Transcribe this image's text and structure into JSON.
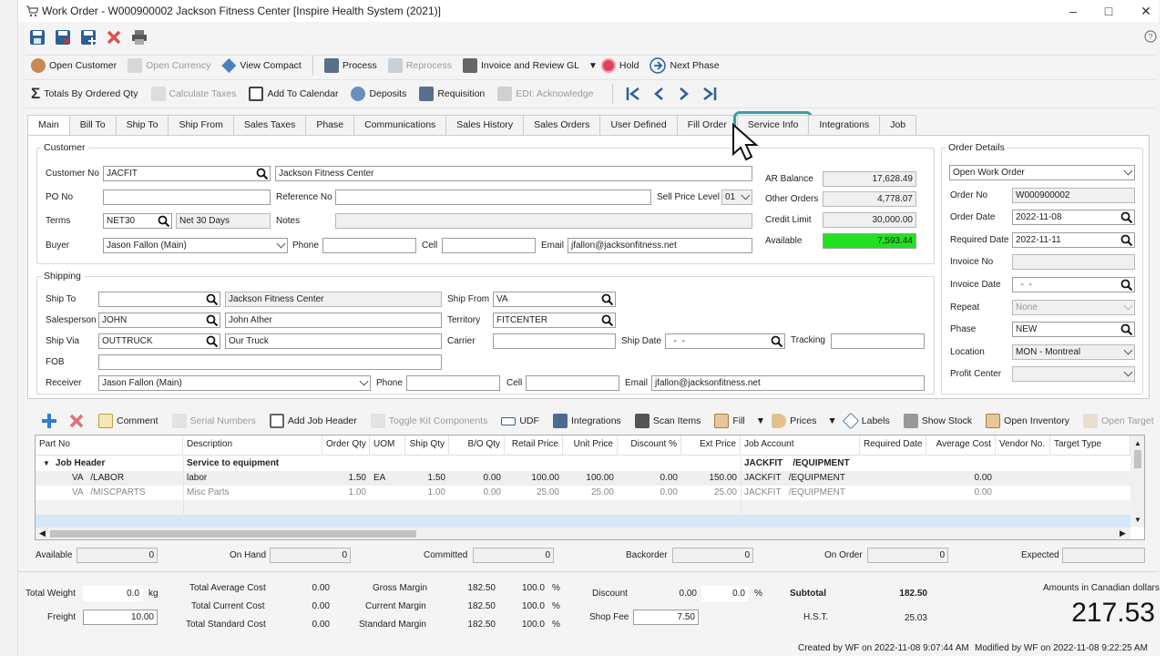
{
  "window": {
    "title": "Work Order - W000900002 Jackson Fitness Center [Inspire Health System (2021)]"
  },
  "toolbar1": [
    "Open Customer",
    "Open Currency",
    "View Compact",
    "Process",
    "Reprocess",
    "Invoice and Review GL",
    "Hold",
    "Next Phase"
  ],
  "toolbar2": [
    "Totals By Ordered Qty",
    "Calculate Taxes",
    "Add To Calendar",
    "Deposits",
    "Requisition",
    "EDI: Acknowledge"
  ],
  "tabs": [
    "Main",
    "Bill To",
    "Ship To",
    "Ship From",
    "Sales Taxes",
    "Phase",
    "Communications",
    "Sales History",
    "Sales Orders",
    "User Defined",
    "Fill Order",
    "Service Info",
    "Integrations",
    "Job"
  ],
  "customer": {
    "title": "Customer",
    "customer_no_label": "Customer No",
    "customer_no": "JACFIT",
    "customer_name": "Jackson Fitness Center",
    "po_label": "PO No",
    "po": "",
    "reference_label": "Reference No",
    "reference": "",
    "sell_price_label": "Sell Price Level",
    "sell_price": "01",
    "terms_label": "Terms",
    "terms": "NET30",
    "terms_desc": "Net 30 Days",
    "notes_label": "Notes",
    "notes": "",
    "buyer_label": "Buyer",
    "buyer": "Jason Fallon (Main)",
    "phone_label": "Phone",
    "phone": "",
    "cell_label": "Cell",
    "cell": "",
    "email_label": "Email",
    "email": "jfallon@jacksonfitness.net",
    "ar_balance_label": "AR Balance",
    "ar_balance": "17,628.49",
    "other_orders_label": "Other Orders",
    "other_orders": "4,778.07",
    "credit_limit_label": "Credit Limit",
    "credit_limit": "30,000.00",
    "available_label": "Available",
    "available": "7,593.44"
  },
  "shipping": {
    "title": "Shipping",
    "ship_to_label": "Ship To",
    "ship_to": "",
    "ship_to_name": "Jackson Fitness Center",
    "ship_from_label": "Ship From",
    "ship_from": "VA",
    "salesperson_label": "Salesperson",
    "salesperson": "JOHN",
    "salesperson_name": "John Ather",
    "territory_label": "Territory",
    "territory": "FITCENTER",
    "ship_via_label": "Ship Via",
    "ship_via": "OUTTRUCK",
    "ship_via_name": "Our Truck",
    "carrier_label": "Carrier",
    "carrier": "",
    "ship_date_label": "Ship Date",
    "ship_date": "  -  -",
    "tracking_label": "Tracking",
    "tracking": "",
    "fob_label": "FOB",
    "fob": "",
    "receiver_label": "Receiver",
    "receiver": "Jason Fallon (Main)",
    "phone_label": "Phone",
    "phone": "",
    "cell_label": "Cell",
    "cell": "",
    "email_label": "Email",
    "email": "jfallon@jacksonfitness.net"
  },
  "order_details": {
    "title": "Order Details",
    "status": "Open Work Order",
    "order_no_label": "Order No",
    "order_no": "W000900002",
    "order_date_label": "Order Date",
    "order_date": "2022-11-08",
    "required_date_label": "Required Date",
    "required_date": "2022-11-11",
    "invoice_no_label": "Invoice No",
    "invoice_no": "",
    "invoice_date_label": "Invoice Date",
    "invoice_date": "  -  -",
    "repeat_label": "Repeat",
    "repeat": "None",
    "phase_label": "Phase",
    "phase": "NEW",
    "location_label": "Location",
    "location": "MON - Montreal",
    "profit_center_label": "Profit Center",
    "profit_center": ""
  },
  "grid_toolbar": [
    "Comment",
    "Serial Numbers",
    "Add Job Header",
    "Toggle Kit Components",
    "UDF",
    "Integrations",
    "Scan Items",
    "Fill",
    "Prices",
    "Labels",
    "Show Stock",
    "Open Inventory",
    "Open Target"
  ],
  "grid": {
    "columns": [
      "Part No",
      "Description",
      "Order Qty",
      "UOM",
      "Ship Qty",
      "B/O Qty",
      "Retail Price",
      "Unit Price",
      "Discount %",
      "Ext Price",
      "Job Account",
      "Required Date",
      "Average Cost",
      "Vendor No.",
      "Target Type"
    ],
    "header_row": {
      "part": "Job Header",
      "description": "Service to equipment",
      "job_account": "JACKFIT    /EQUIPMENT"
    },
    "rows": [
      [
        "VA   /LABOR",
        "labor",
        "1.50",
        "EA",
        "1.50",
        "0.00",
        "100.00",
        "100.00",
        "0.00",
        "150.00",
        "JACKFIT   /EQUIPMENT",
        "",
        "0.00",
        "",
        ""
      ],
      [
        "VA   /MISCPARTS",
        "Misc Parts",
        "1.00",
        "",
        "1.00",
        "0.00",
        "25.00",
        "25.00",
        "0.00",
        "25.00",
        "JACKFIT   /EQUIPMENT",
        "",
        "0.00",
        "",
        ""
      ]
    ]
  },
  "stock": {
    "available_label": "Available",
    "available": "0",
    "on_hand_label": "On Hand",
    "on_hand": "0",
    "committed_label": "Committed",
    "committed": "0",
    "backorder_label": "Backorder",
    "backorder": "0",
    "on_order_label": "On Order",
    "on_order": "0",
    "expected_label": "Expected",
    "expected": ""
  },
  "totals": {
    "total_weight_label": "Total Weight",
    "total_weight": "0.0",
    "weight_unit": "kg",
    "freight_label": "Freight",
    "freight": "10.00",
    "total_avg_cost_label": "Total Average Cost",
    "total_avg_cost": "0.00",
    "total_current_cost_label": "Total Current Cost",
    "total_current_cost": "0.00",
    "total_standard_cost_label": "Total Standard Cost",
    "total_standard_cost": "0.00",
    "gross_margin_label": "Gross Margin",
    "gross_margin": "182.50",
    "gross_margin_pct": "100.0",
    "current_margin_label": "Current Margin",
    "current_margin": "182.50",
    "current_margin_pct": "100.0",
    "standard_margin_label": "Standard Margin",
    "standard_margin": "182.50",
    "standard_margin_pct": "100.0",
    "pct_sign": "%",
    "discount_label": "Discount",
    "discount": "0.00",
    "discount_pct": "0.0",
    "shop_fee_label": "Shop Fee",
    "shop_fee": "7.50",
    "subtotal_label": "Subtotal",
    "subtotal": "182.50",
    "hst_label": "H.S.T.",
    "hst": "25.03",
    "currency_note": "Amounts in Canadian dollars",
    "grand_total": "217.53"
  },
  "footer": {
    "created": "Created by WF on 2022-11-08 9:07:44 AM",
    "modified": "Modified by WF on 2022-11-08 9:22:25 AM"
  },
  "colors": {
    "available_bg": "#22e022",
    "focus_ring": "#3a9fa8",
    "grid_selected": "#d6e8f7"
  }
}
